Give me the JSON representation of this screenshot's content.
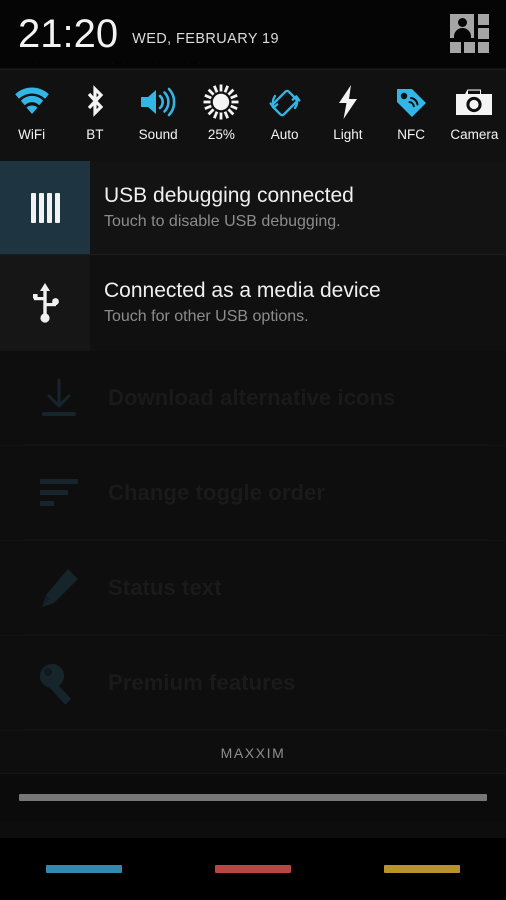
{
  "statusbar": {
    "time": "21:20",
    "date": "WED, FEBRUARY 19",
    "profile_icon": "user-grid-icon",
    "ghost_text": "· · · · · · · · · · · · · · · · · · ·"
  },
  "quick_settings": {
    "toggles": [
      {
        "label": "WiFi",
        "icon": "wifi-icon",
        "active": true,
        "color": "#33b5e5"
      },
      {
        "label": "BT",
        "icon": "bluetooth-icon",
        "active": false,
        "color": "#f4f4f4"
      },
      {
        "label": "Sound",
        "icon": "volume-icon",
        "active": true,
        "color": "#33b5e5"
      },
      {
        "label": "25%",
        "icon": "brightness-icon",
        "active": false,
        "color": "#f4f4f4"
      },
      {
        "label": "Auto",
        "icon": "auto-rotate-icon",
        "active": true,
        "color": "#33b5e5"
      },
      {
        "label": "Light",
        "icon": "flashlight-icon",
        "active": false,
        "color": "#f4f4f4"
      },
      {
        "label": "NFC",
        "icon": "nfc-tag-icon",
        "active": true,
        "color": "#33b5e5"
      },
      {
        "label": "Camera",
        "icon": "camera-icon",
        "active": false,
        "color": "#f4f4f4"
      }
    ]
  },
  "notifications": [
    {
      "title": "USB debugging connected",
      "subtitle": "Touch to disable USB debugging.",
      "icon": "usb-debug-icon",
      "icon_bg": "#1e3440"
    },
    {
      "title": "Connected as a media device",
      "subtitle": "Touch for other USB options.",
      "icon": "usb-icon",
      "icon_bg": "#161616"
    }
  ],
  "app_background": {
    "rows": [
      {
        "label": "Download alternative icons",
        "icon": "download-icon"
      },
      {
        "label": "Change toggle order",
        "icon": "list-order-icon"
      },
      {
        "label": "Status text",
        "icon": "pencil-icon"
      },
      {
        "label": "Premium features",
        "icon": "key-icon"
      }
    ],
    "brand": "MAXXIM"
  },
  "drag_handle": {
    "name": "notification-shade-handle"
  },
  "navbar": {
    "buttons": [
      {
        "name": "back-button",
        "color": "#3488ab"
      },
      {
        "name": "home-button",
        "color": "#b94545"
      },
      {
        "name": "recents-button",
        "color": "#b8922a"
      }
    ]
  }
}
